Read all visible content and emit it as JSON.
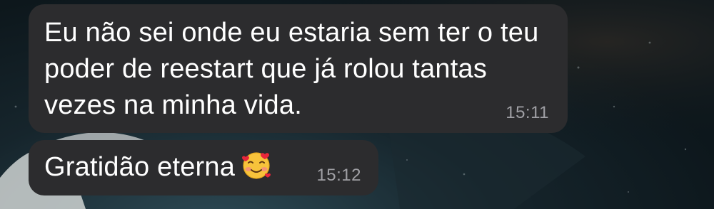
{
  "conversation": {
    "messages": [
      {
        "text": "Eu não sei onde eu estaria sem ter o teu\npoder de reestart que já rolou tantas\nvezes na minha vida.",
        "time": "15:11"
      },
      {
        "text": "Gratidão eterna",
        "emoji": "smiling-face-with-hearts-icon",
        "time": "15:12"
      }
    ]
  },
  "colors": {
    "bubble": "#2c2c2e",
    "text": "#ffffff",
    "timestamp": "#a0a0a5"
  }
}
